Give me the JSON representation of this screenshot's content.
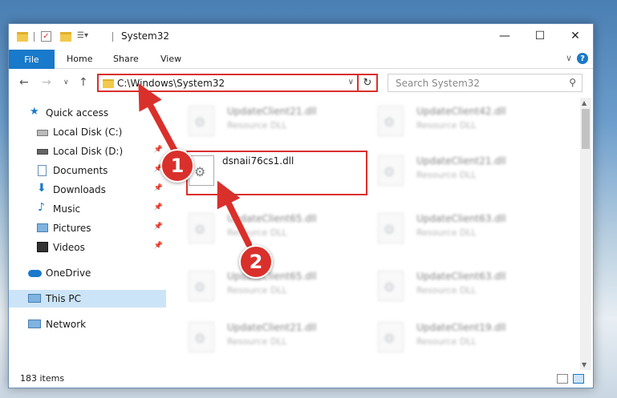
{
  "window": {
    "title": "System32",
    "colors": {
      "accent": "#1979ca",
      "highlight": "#d9302c"
    }
  },
  "ribbon": {
    "file": "File",
    "home": "Home",
    "share": "Share",
    "view": "View",
    "expand": "∨",
    "help": "?"
  },
  "nav": {
    "address": "C:\\Windows\\System32",
    "search_placeholder": "Search System32"
  },
  "sidebar": {
    "items": [
      {
        "label": "Quick access",
        "icon": "star-icon"
      },
      {
        "label": "Local Disk (C:)",
        "icon": "drive-icon"
      },
      {
        "label": "Local Disk (D:)",
        "icon": "drive-icon"
      },
      {
        "label": "Documents",
        "icon": "documents-icon"
      },
      {
        "label": "Downloads",
        "icon": "download-icon"
      },
      {
        "label": "Music",
        "icon": "music-icon"
      },
      {
        "label": "Pictures",
        "icon": "pictures-icon"
      },
      {
        "label": "Videos",
        "icon": "videos-icon"
      },
      {
        "label": "OneDrive",
        "icon": "cloud-icon"
      },
      {
        "label": "This PC",
        "icon": "computer-icon"
      },
      {
        "label": "Network",
        "icon": "network-icon"
      }
    ]
  },
  "files": {
    "left": [
      {
        "name": "UpdateClient21.dll",
        "type": "Resource DLL"
      },
      {
        "name": "dsnaii76cs1.dll",
        "type": ""
      },
      {
        "name": "UpdateClient65.dll",
        "type": "Resource DLL"
      },
      {
        "name": "UpdateClient65.dll",
        "type": "Resource DLL"
      },
      {
        "name": "UpdateClient21.dll",
        "type": "Resource DLL"
      }
    ],
    "right": [
      {
        "name": "UpdateClient42.dll",
        "type": "Resource DLL"
      },
      {
        "name": "UpdateClient21.dll",
        "type": "Resource DLL"
      },
      {
        "name": "UpdateClient63.dll",
        "type": "Resource DLL"
      },
      {
        "name": "UpdateClient63.dll",
        "type": "Resource DLL"
      },
      {
        "name": "UpdateClient19.dll",
        "type": "Resource DLL"
      }
    ]
  },
  "status": {
    "items": "183 items"
  },
  "callouts": {
    "one": "1",
    "two": "2"
  }
}
